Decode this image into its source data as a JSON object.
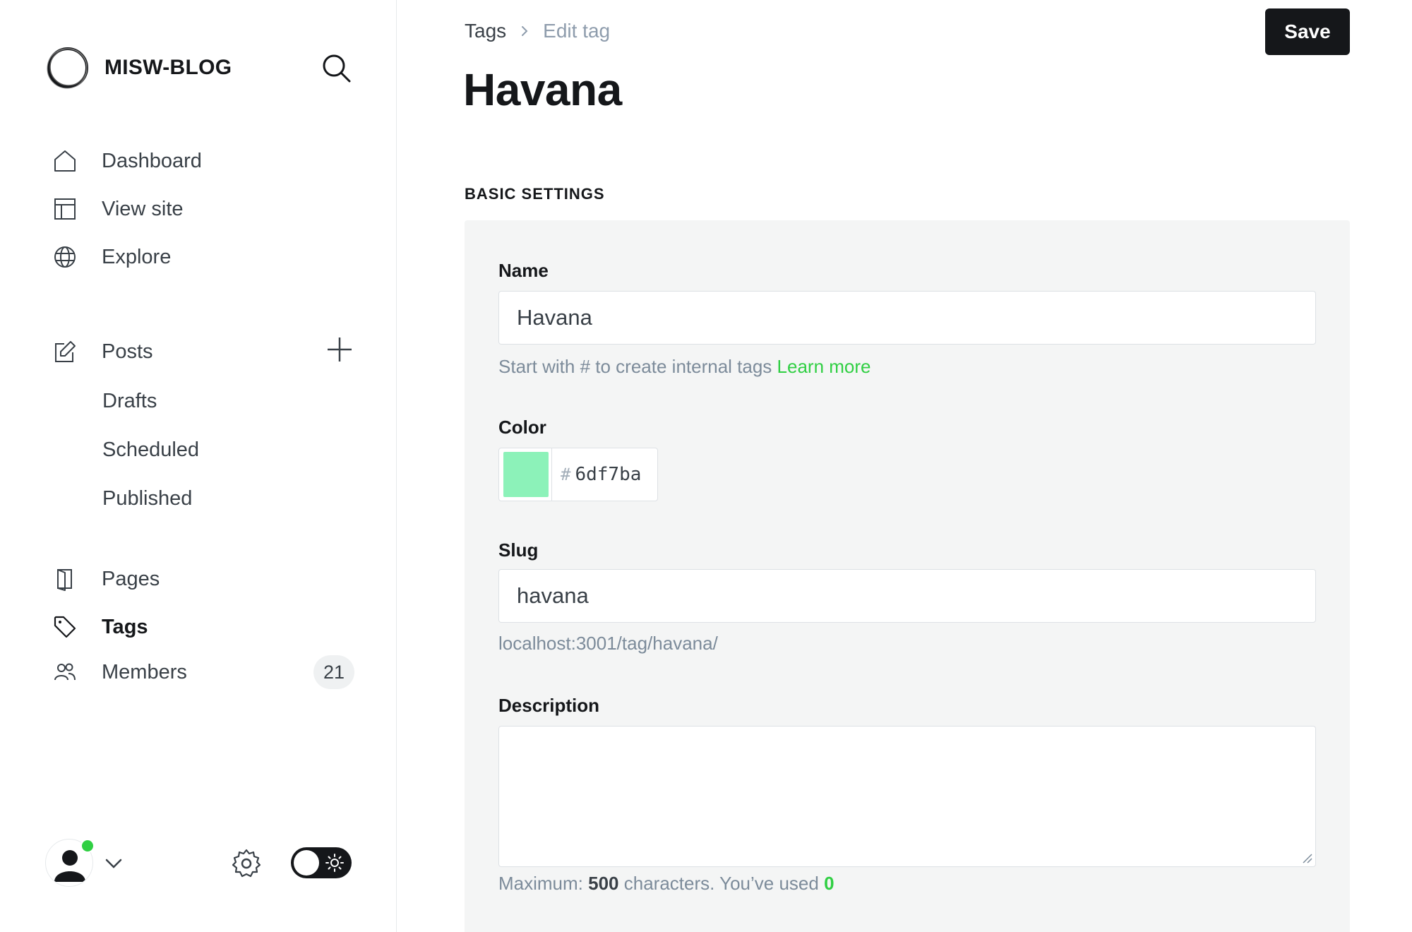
{
  "sidebar": {
    "brand": "MISW-BLOG",
    "nav_primary": [
      {
        "label": "Dashboard",
        "icon": "home-icon"
      },
      {
        "label": "View site",
        "icon": "layout-icon"
      },
      {
        "label": "Explore",
        "icon": "globe-icon"
      }
    ],
    "posts": {
      "label": "Posts",
      "icon": "edit-icon"
    },
    "post_subitems": [
      "Drafts",
      "Scheduled",
      "Published"
    ],
    "nav_secondary": [
      {
        "label": "Pages",
        "icon": "pages-icon"
      },
      {
        "label": "Tags",
        "icon": "tag-icon",
        "active": true
      },
      {
        "label": "Members",
        "icon": "members-icon",
        "count": "21"
      }
    ],
    "status_color": "#30cf43"
  },
  "header": {
    "breadcrumb_parent": "Tags",
    "breadcrumb_current": "Edit tag",
    "save_label": "Save",
    "title": "Havana"
  },
  "basic_settings": {
    "heading": "BASIC SETTINGS",
    "name": {
      "label": "Name",
      "value": "Havana",
      "hint": "Start with # to create internal tags",
      "hint_link": "Learn more"
    },
    "color": {
      "label": "Color",
      "hash": "#",
      "value": "6df7ba",
      "swatch": "#8cf2b9"
    },
    "slug": {
      "label": "Slug",
      "value": "havana",
      "url": "localhost:3001/tag/havana/"
    },
    "description": {
      "label": "Description",
      "value": "",
      "hint_prefix": "Maximum:",
      "max": "500",
      "hint_middle": "characters. You’ve used",
      "used": "0"
    }
  }
}
